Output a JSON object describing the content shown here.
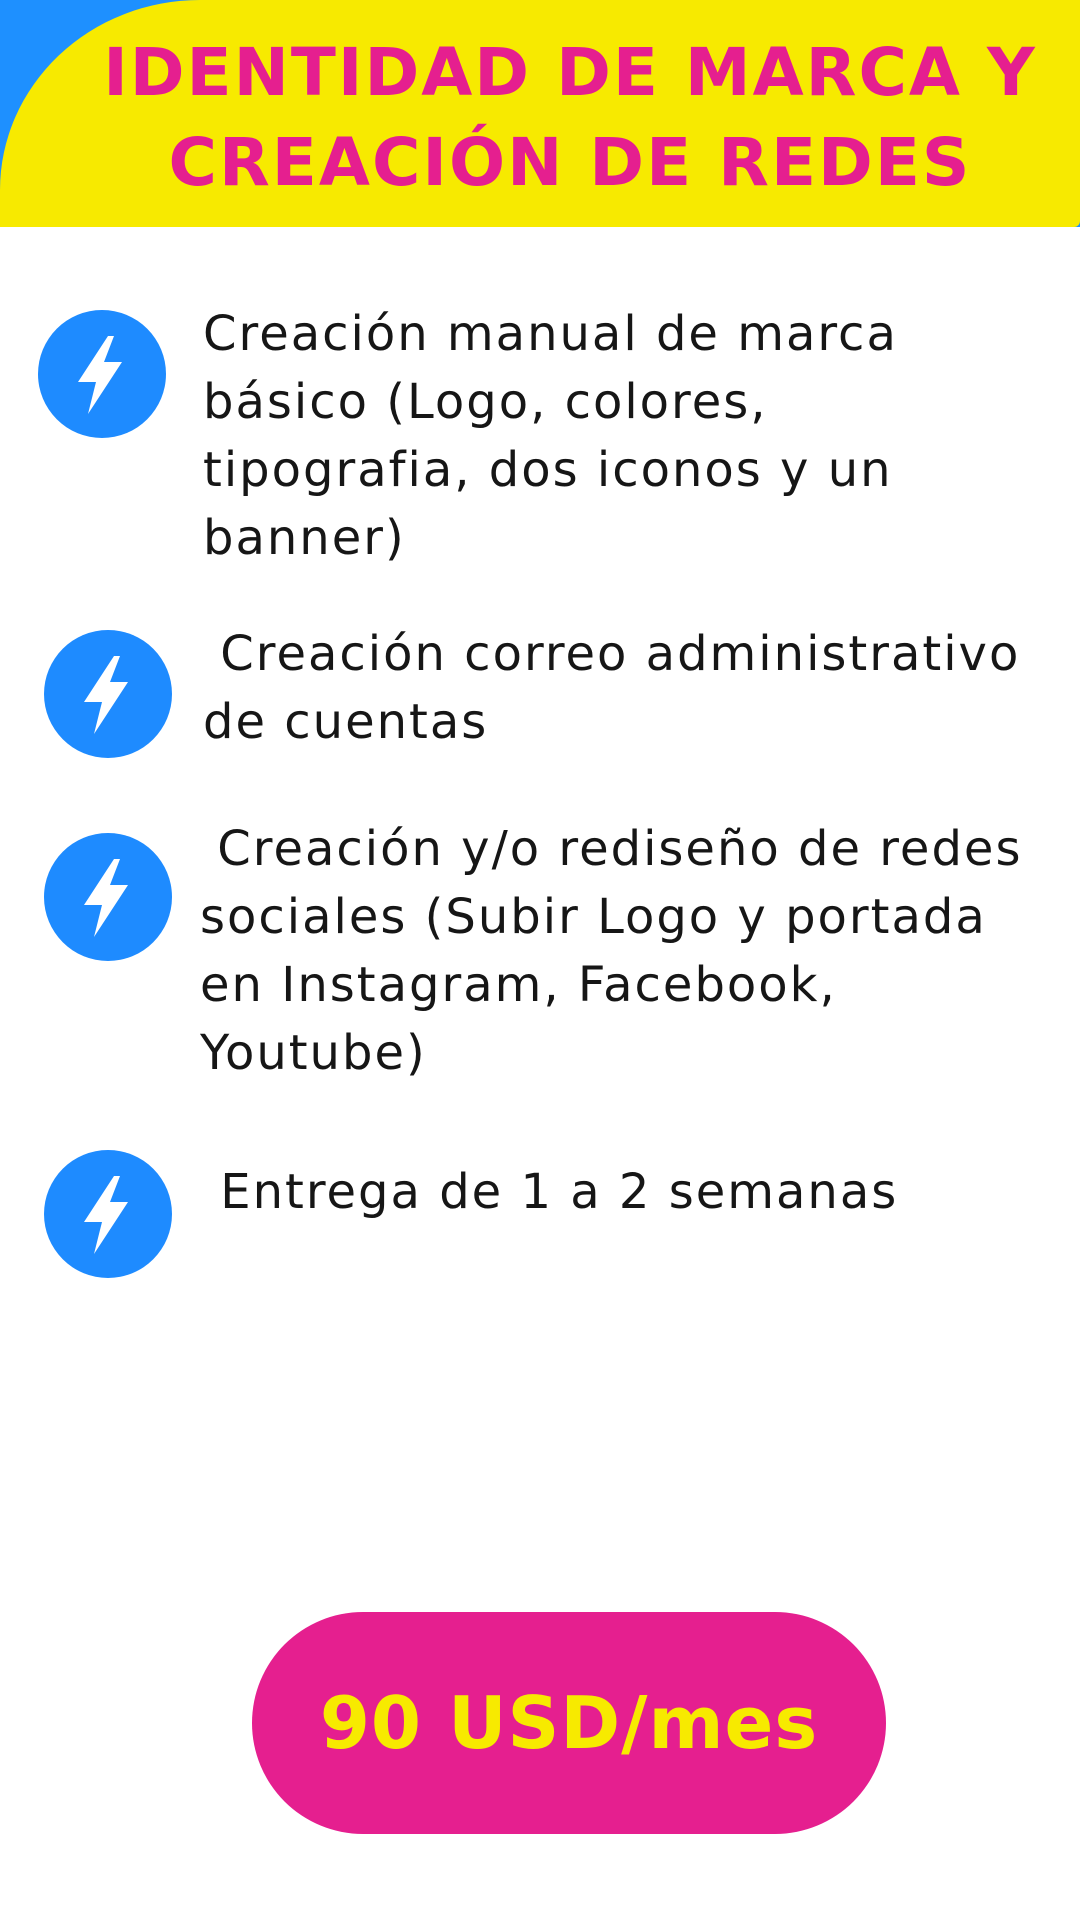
{
  "header": {
    "title": "IDENTIDAD DE MARCA Y\nCREACIÓN DE REDES"
  },
  "features": [
    {
      "icon": "lightning-bolt-icon",
      "text": "Creación manual de marca\nbásico (Logo, colores,\ntipografia, dos iconos y un\nbanner)"
    },
    {
      "icon": "lightning-bolt-icon",
      "text": " Creación correo administrativo\nde cuentas"
    },
    {
      "icon": "lightning-bolt-icon",
      "text": " Creación y/o rediseño de redes\nsociales (Subir Logo y portada\nen Instagram, Facebook,\nYoutube)"
    },
    {
      "icon": "lightning-bolt-icon",
      "text": " Entrega de 1 a 2 semanas"
    }
  ],
  "price": {
    "label": "90 USD/mes"
  },
  "colors": {
    "header_yellow": "#f7ea00",
    "accent_blue": "#1e8bff",
    "accent_pink": "#e51f8f",
    "text_dark": "#161616"
  }
}
